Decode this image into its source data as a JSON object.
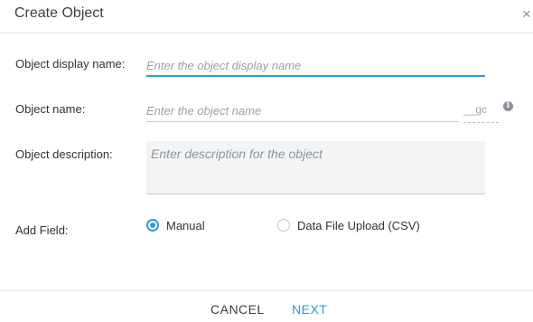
{
  "dialog": {
    "title": "Create Object",
    "close_icon": "close-icon",
    "close_glyph": "×"
  },
  "form": {
    "display_name": {
      "label": "Object display name:",
      "value": "",
      "placeholder": "Enter the object display name"
    },
    "object_name": {
      "label": "Object name:",
      "value": "",
      "placeholder": "Enter the object name",
      "suffix": "__gc",
      "info_icon": "info-icon",
      "info_glyph": "i"
    },
    "description": {
      "label": "Object description:",
      "value": "",
      "placeholder": "Enter description for the object"
    },
    "add_field": {
      "label": "Add Field:",
      "options": [
        {
          "label": "Manual",
          "selected": true
        },
        {
          "label": "Data File Upload (CSV)",
          "selected": false
        }
      ]
    }
  },
  "footer": {
    "cancel_label": "CANCEL",
    "next_label": "NEXT"
  },
  "colors": {
    "accent": "#2c9ad6",
    "text": "#2e3339",
    "placeholder": "#9aa1aa",
    "divider": "#dfe3e8",
    "textarea_bg": "#f3f4f5"
  }
}
